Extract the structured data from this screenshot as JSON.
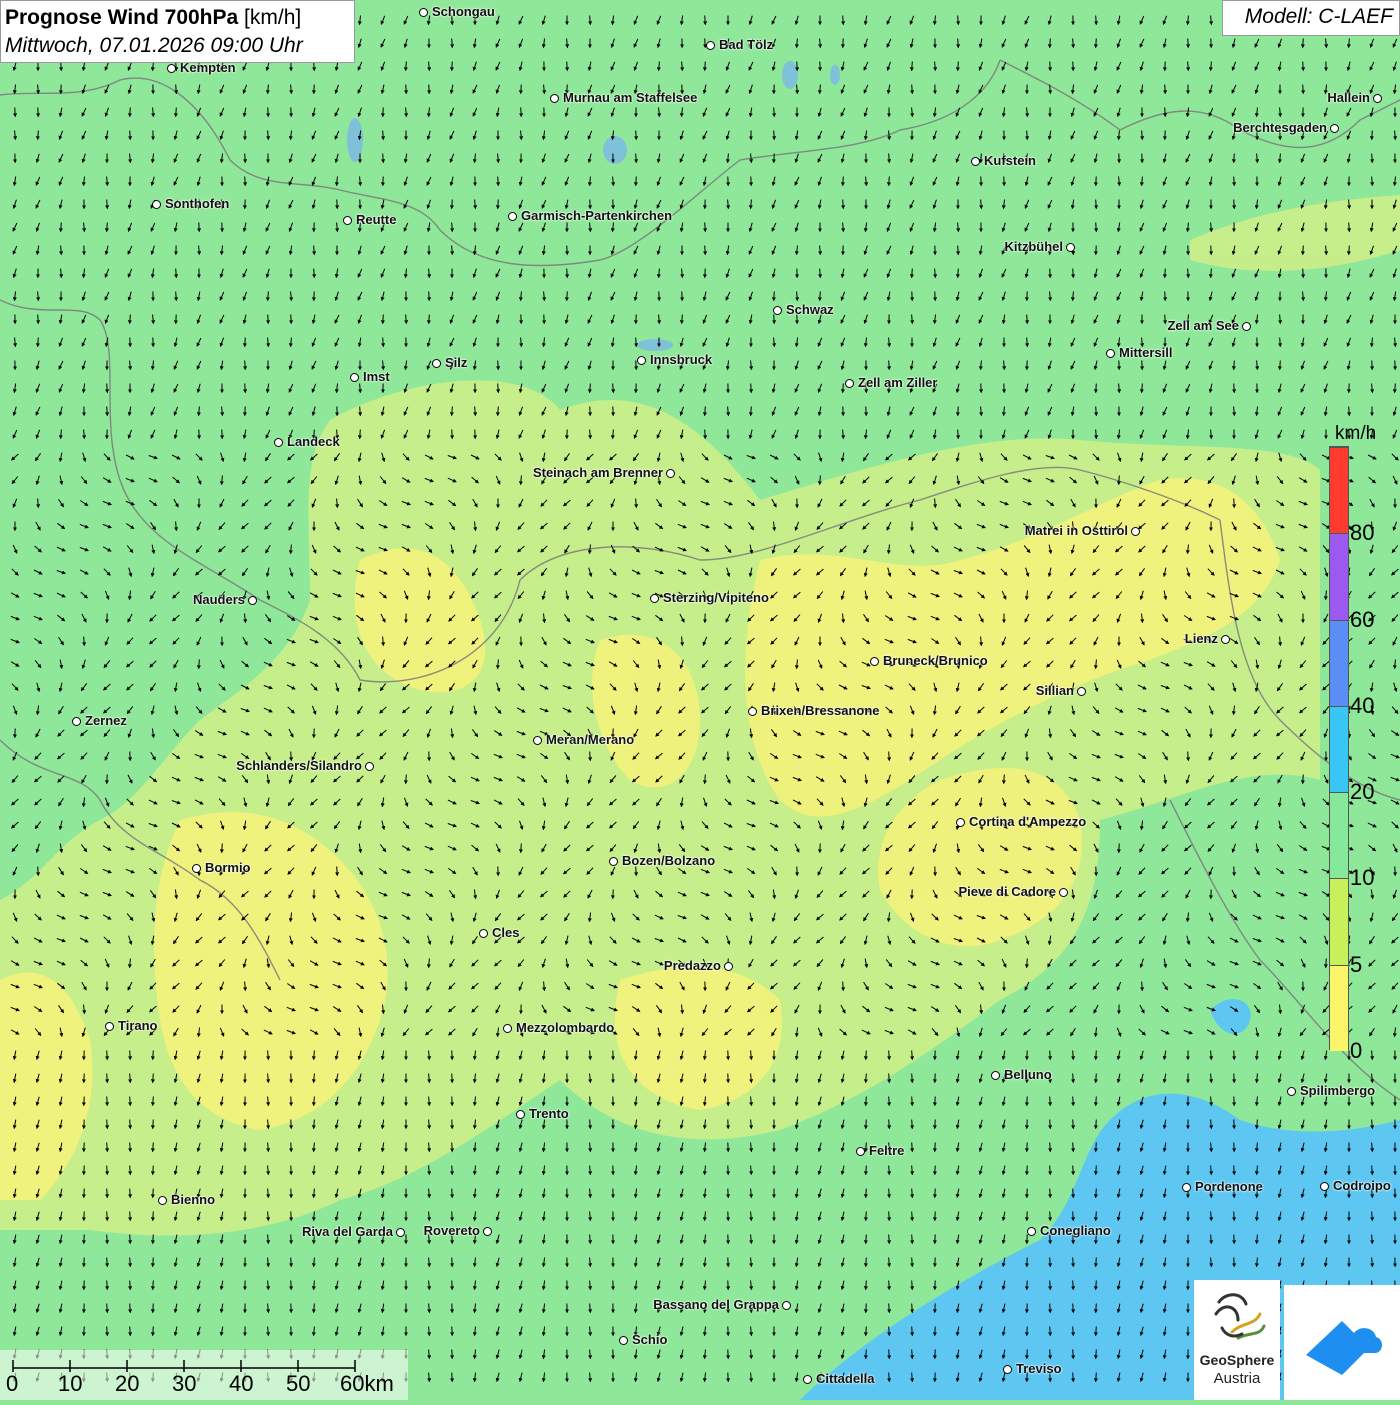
{
  "title": {
    "main": "Prognose Wind 700hPa",
    "unit": "[km/h]",
    "datetime": "Mittwoch, 07.01.2026 09:00 Uhr"
  },
  "model": "Modell: C-LAEF",
  "legend": {
    "unit": "km/h",
    "ticks": [
      "80",
      "60",
      "40",
      "20",
      "10",
      "5",
      "0"
    ],
    "colors": [
      "#ff3b30",
      "#9b59f0",
      "#5b8ef5",
      "#39c5f5",
      "#86e89a",
      "#c8f05a",
      "#fbf56a"
    ]
  },
  "scale": {
    "labels": [
      "0",
      "10",
      "20",
      "30",
      "40",
      "50",
      "60km"
    ]
  },
  "logos": {
    "geosphere_line1": "GeoSphere",
    "geosphere_line2": "Austria"
  },
  "cities": [
    {
      "name": "Schongau"
    },
    {
      "name": "Bad Tölz"
    },
    {
      "name": "Kempten"
    },
    {
      "name": "Murnau am Staffelsee"
    },
    {
      "name": "Hallein"
    },
    {
      "name": "Berchtesgaden"
    },
    {
      "name": "Kufstein"
    },
    {
      "name": "Sonthofen"
    },
    {
      "name": "Reutte"
    },
    {
      "name": "Garmisch-Partenkirchen"
    },
    {
      "name": "Kitzbühel"
    },
    {
      "name": "Schwaz"
    },
    {
      "name": "Zell am See"
    },
    {
      "name": "Mittersill"
    },
    {
      "name": "Innsbruck"
    },
    {
      "name": "Silz"
    },
    {
      "name": "Imst"
    },
    {
      "name": "Zell am Ziller"
    },
    {
      "name": "Landeck"
    },
    {
      "name": "Steinach am Brenner"
    },
    {
      "name": "Matrei in Osttirol"
    },
    {
      "name": "Nauders"
    },
    {
      "name": "Sterzing/Vipiteno"
    },
    {
      "name": "Lienz"
    },
    {
      "name": "Bruneck/Brunico"
    },
    {
      "name": "Sillian"
    },
    {
      "name": "Brixen/Bressanone"
    },
    {
      "name": "Zernez"
    },
    {
      "name": "Meran/Merano"
    },
    {
      "name": "Schlanders/Silandro"
    },
    {
      "name": "Cortina d'Ampezzo"
    },
    {
      "name": "Bozen/Bolzano"
    },
    {
      "name": "Bormio"
    },
    {
      "name": "Pieve di Cadore"
    },
    {
      "name": "Cles"
    },
    {
      "name": "Predazzo"
    },
    {
      "name": "Tirano"
    },
    {
      "name": "Mezzolombardo"
    },
    {
      "name": "Belluno"
    },
    {
      "name": "Spilimbergo"
    },
    {
      "name": "Trento"
    },
    {
      "name": "Feltre"
    },
    {
      "name": "Bienno"
    },
    {
      "name": "Pordenone"
    },
    {
      "name": "Codroipo"
    },
    {
      "name": "Riva del Garda"
    },
    {
      "name": "Rovereto"
    },
    {
      "name": "Conegliano"
    },
    {
      "name": "Bassano del Grappa"
    },
    {
      "name": "Schio"
    },
    {
      "name": "Treviso"
    },
    {
      "name": "Cittadella"
    }
  ]
}
